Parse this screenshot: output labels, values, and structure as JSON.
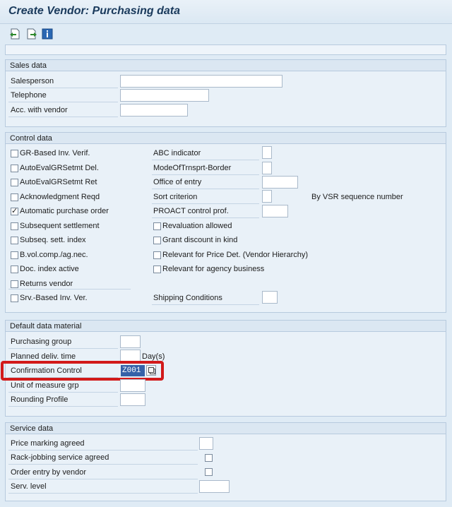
{
  "window": {
    "title": "Create Vendor: Purchasing data"
  },
  "toolbar": {
    "icons": [
      "previous-screen-icon",
      "next-screen-icon",
      "info-icon"
    ]
  },
  "sales": {
    "header": "Sales data",
    "salesperson": "Salesperson",
    "telephone": "Telephone",
    "acc_with_vendor": "Acc. with vendor"
  },
  "control": {
    "header": "Control data",
    "left": [
      {
        "label": "GR-Based Inv. Verif.",
        "checked": false
      },
      {
        "label": "AutoEvalGRSetmt Del.",
        "checked": false
      },
      {
        "label": "AutoEvalGRSetmt Ret",
        "checked": false
      },
      {
        "label": "Acknowledgment Reqd",
        "checked": false
      },
      {
        "label": "Automatic purchase order",
        "checked": true
      },
      {
        "label": "Subsequent settlement",
        "checked": false
      },
      {
        "label": "Subseq. sett. index",
        "checked": false
      },
      {
        "label": "B.vol.comp./ag.nec.",
        "checked": false
      },
      {
        "label": "Doc. index active",
        "checked": false
      },
      {
        "label": "Returns vendor",
        "checked": false
      },
      {
        "label": "Srv.-Based Inv. Ver.",
        "checked": false
      }
    ],
    "abc_indicator": "ABC indicator",
    "mode_border": "ModeOfTrnsprt-Border",
    "office_of_entry": "Office of entry",
    "sort_criterion": "Sort criterion",
    "sort_criterion_text": "By VSR sequence number",
    "proact": "PROACT control prof.",
    "revaluation": "Revaluation allowed",
    "grant_discount": "Grant discount in kind",
    "relevant_price": "Relevant for Price Det. (Vendor Hierarchy)",
    "relevant_agency": "Relevant for agency business",
    "shipping_conditions": "Shipping Conditions"
  },
  "material": {
    "header": "Default data material",
    "purchasing_group": "Purchasing group",
    "planned_delivery": "Planned deliv. time",
    "days_unit": "Day(s)",
    "confirmation_control": "Confirmation Control",
    "confirmation_value": "Z001",
    "unit_of_measure": "Unit of measure grp",
    "rounding_profile": "Rounding Profile"
  },
  "service": {
    "header": "Service data",
    "price_marking": "Price marking agreed",
    "rack_jobbing": "Rack-jobbing service agreed",
    "order_entry": "Order entry by vendor",
    "serv_level": "Serv. level"
  }
}
